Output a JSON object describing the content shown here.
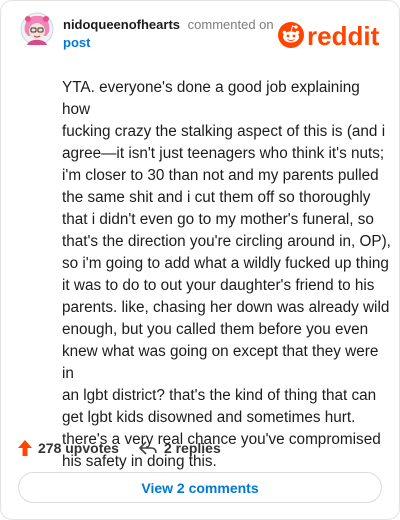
{
  "header": {
    "username": "nidoqueenofhearts",
    "action": "commented on",
    "post_label": "post",
    "logo_word": "reddit"
  },
  "comment": {
    "text": "YTA. everyone's done a good job explaining how\nfucking crazy the stalking aspect of this is (and i\nagree—it isn't just teenagers who think it's nuts;\ni'm closer to 30 than not and my parents pulled\nthe same shit and i cut them off so thoroughly\nthat i didn't even go to my mother's funeral, so\nthat's the direction you're circling around in, OP),\nso i'm going to add what a wildly fucked up thing\nit was to do to out your daughter's friend to his\nparents. like, chasing her down was already wild\nenough, but you called them before you even\nknew what was going on except that they were in\nan lgbt district? that's the kind of thing that can\nget lgbt kids disowned and sometimes hurt.\nthere's a very real chance you've compromised\nhis safety in doing this."
  },
  "footer": {
    "upvotes": "278 upvotes",
    "replies": "2 replies",
    "view_comments": "View 2 comments"
  },
  "colors": {
    "accent_orange": "#ff4500",
    "link_blue": "#0079d3",
    "avatar_pink": "#f7a3c8"
  }
}
